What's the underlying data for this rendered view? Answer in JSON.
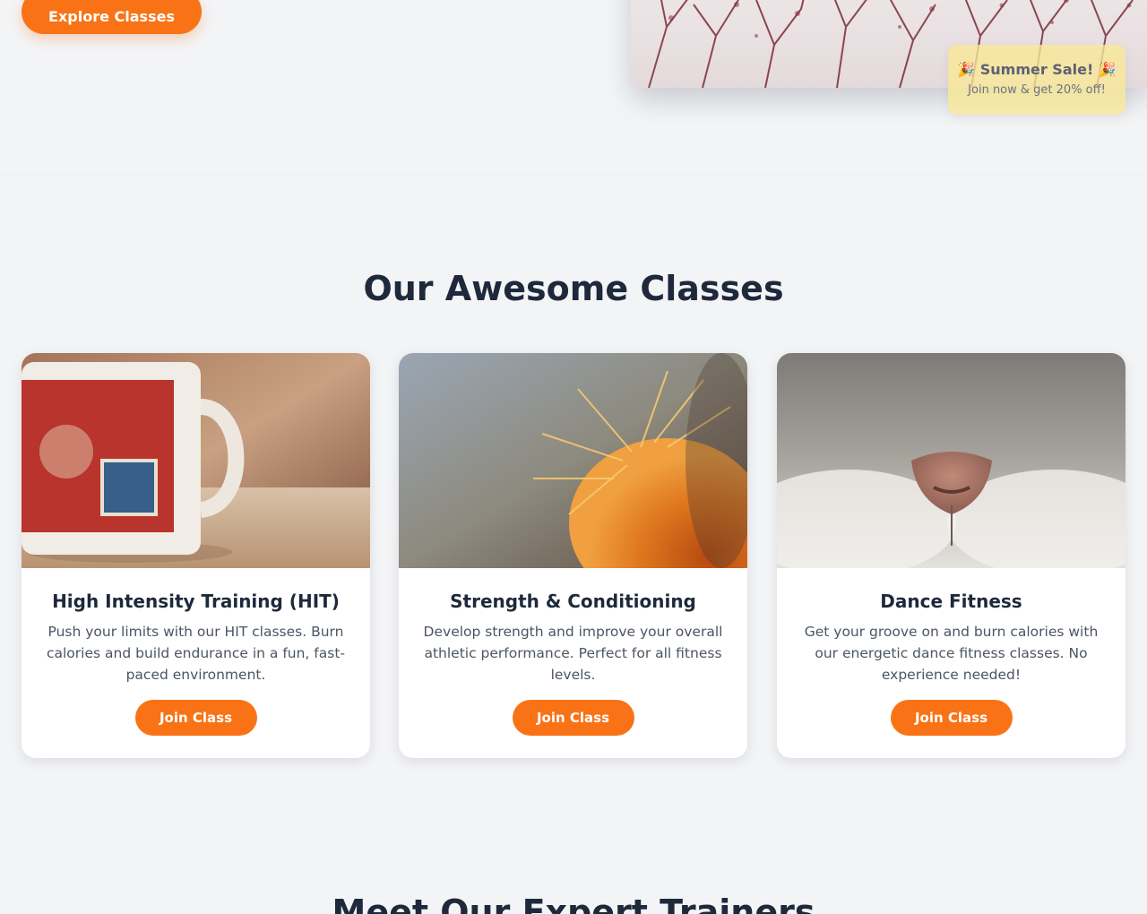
{
  "hero": {
    "cta_label": "Explore Classes",
    "promo": {
      "title": "🎉 Summer Sale! 🎉",
      "subtitle": "Join now & get 20% off!"
    }
  },
  "classes": {
    "heading": "Our Awesome Classes",
    "items": [
      {
        "title": "High Intensity Training (HIT)",
        "description": "Push your limits with our HIT classes. Burn calories and build endurance in a fun, fast-paced environment.",
        "button_label": "Join Class",
        "image": "mug-photo"
      },
      {
        "title": "Strength & Conditioning",
        "description": "Develop strength and improve your overall athletic performance. Perfect for all fitness levels.",
        "button_label": "Join Class",
        "image": "cactus-photo"
      },
      {
        "title": "Dance Fitness",
        "description": "Get your groove on and burn calories with our energetic dance fitness classes. No experience needed!",
        "button_label": "Join Class",
        "image": "cat-nose-photo"
      }
    ]
  },
  "trainers": {
    "heading": "Meet Our Expert Trainers"
  },
  "colors": {
    "accent": "#f97316",
    "heading": "#1e293b",
    "body_text": "#4b5563",
    "background": "#f3f4f6"
  }
}
